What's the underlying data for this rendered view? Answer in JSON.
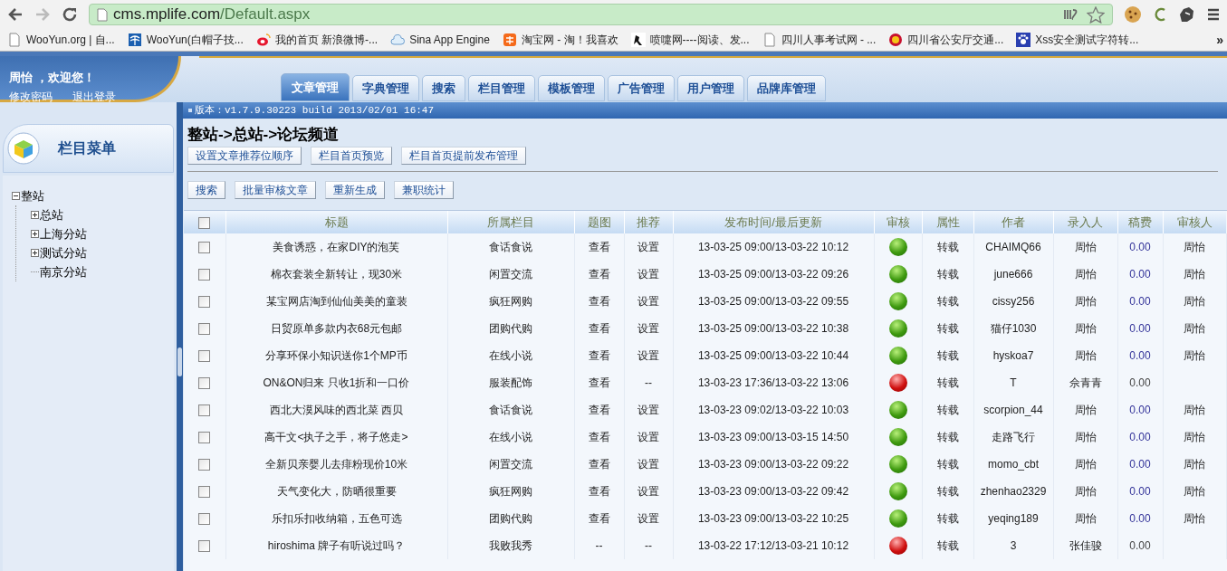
{
  "browser": {
    "address": {
      "host": "cms.mplife.com",
      "path": "/Default.aspx"
    },
    "bookmarks": [
      {
        "label": "WooYun.org | 自...",
        "kind": "page"
      },
      {
        "label": "WooYun(白帽子技...",
        "kind": "telecom"
      },
      {
        "label": "我的首页 新浪微博-...",
        "kind": "weibo"
      },
      {
        "label": "Sina App Engine",
        "kind": "cloud"
      },
      {
        "label": "淘宝网 - 淘！我喜欢",
        "kind": "shop"
      },
      {
        "label": "喷嚏网----阅读、发...",
        "kind": "figure"
      },
      {
        "label": "四川人事考试网 - ...",
        "kind": "page"
      },
      {
        "label": "四川省公安厅交通...",
        "kind": "emblem"
      },
      {
        "label": "Xss安全测试字符转...",
        "kind": "paw"
      }
    ],
    "more": "»"
  },
  "user": {
    "greeting": "周怡 ，欢迎您！",
    "links": [
      "修改密码",
      "退出登录"
    ]
  },
  "tabs": [
    {
      "label": "文章管理",
      "selected": true
    },
    {
      "label": "字典管理",
      "selected": false
    },
    {
      "label": "搜索",
      "selected": false
    },
    {
      "label": "栏目管理",
      "selected": false
    },
    {
      "label": "模板管理",
      "selected": false
    },
    {
      "label": "广告管理",
      "selected": false
    },
    {
      "label": "用户管理",
      "selected": false
    },
    {
      "label": "品牌库管理",
      "selected": false
    }
  ],
  "version": "版本：v1.7.9.30223 build 2013/02/01 16:47",
  "sidebar": {
    "title": "栏目菜单",
    "tree": [
      {
        "label": "整站",
        "kind": "folder",
        "expanded": true,
        "children": [
          {
            "label": "总站",
            "kind": "folder",
            "expanded": false
          },
          {
            "label": "上海分站",
            "kind": "folder",
            "expanded": false
          },
          {
            "label": "测试分站",
            "kind": "folder",
            "expanded": false
          },
          {
            "label": "南京分站",
            "kind": "leaf"
          }
        ]
      }
    ]
  },
  "breadcrumb": "整站->总站->论坛频道",
  "toolbar_1": [
    "设置文章推荐位顺序",
    "栏目首页预览",
    "栏目首页提前发布管理"
  ],
  "toolbar_2": [
    "搜索",
    "批量审核文章",
    "重新生成",
    "兼职统计"
  ],
  "table": {
    "select_all": {
      "checked": false
    },
    "columns": [
      "标题",
      "所属栏目",
      "题图",
      "推荐",
      "发布时间/最后更新",
      "审核",
      "属性",
      "作者",
      "录入人",
      "稿费",
      "审核人"
    ],
    "rows": [
      {
        "checked": false,
        "title": "美食诱惑，在家DIY的泡芙",
        "section": "食话食说",
        "image": "查看",
        "recommend": "设置",
        "time": "13-03-25 09:00/13-03-22 10:12",
        "approved": true,
        "attribute": "转载",
        "author": "CHAIMQ66",
        "editor": "周怡",
        "fee": "0.00",
        "reviewer": "周怡"
      },
      {
        "checked": false,
        "title": "棉衣套装全新转让，现30米",
        "section": "闲置交流",
        "image": "查看",
        "recommend": "设置",
        "time": "13-03-25 09:00/13-03-22 09:26",
        "approved": true,
        "attribute": "转载",
        "author": "june666",
        "editor": "周怡",
        "fee": "0.00",
        "reviewer": "周怡"
      },
      {
        "checked": false,
        "title": "某宝网店淘到仙仙美美的童装",
        "section": "疯狂网购",
        "image": "查看",
        "recommend": "设置",
        "time": "13-03-25 09:00/13-03-22 09:55",
        "approved": true,
        "attribute": "转载",
        "author": "cissy256",
        "editor": "周怡",
        "fee": "0.00",
        "reviewer": "周怡"
      },
      {
        "checked": false,
        "title": "日贸原单多款内衣68元包邮",
        "section": "团购代购",
        "image": "查看",
        "recommend": "设置",
        "time": "13-03-25 09:00/13-03-22 10:38",
        "approved": true,
        "attribute": "转载",
        "author": "猫仔1030",
        "editor": "周怡",
        "fee": "0.00",
        "reviewer": "周怡"
      },
      {
        "checked": false,
        "title": "分享环保小知识送你1个MP币",
        "section": "在线小说",
        "image": "查看",
        "recommend": "设置",
        "time": "13-03-25 09:00/13-03-22 10:44",
        "approved": true,
        "attribute": "转载",
        "author": "hyskoa7",
        "editor": "周怡",
        "fee": "0.00",
        "reviewer": "周怡"
      },
      {
        "checked": false,
        "title": "ON&ON归来 只收1折和一口价",
        "section": "服装配饰",
        "image": "查看",
        "recommend": "--",
        "time": "13-03-23 17:36/13-03-22 13:06",
        "approved": false,
        "attribute": "转载",
        "author": "T",
        "editor": "佘青青",
        "fee": "0.00"
      },
      {
        "checked": false,
        "title": "西北大漠风味的西北菜 西贝",
        "section": "食话食说",
        "image": "查看",
        "recommend": "设置",
        "time": "13-03-23 09:02/13-03-22 10:03",
        "approved": true,
        "attribute": "转载",
        "author": "scorpion_44",
        "editor": "周怡",
        "fee": "0.00",
        "reviewer": "周怡"
      },
      {
        "checked": false,
        "title": "高干文<执子之手，将子悠走>",
        "section": "在线小说",
        "image": "查看",
        "recommend": "设置",
        "time": "13-03-23 09:00/13-03-15 14:50",
        "approved": true,
        "attribute": "转载",
        "author": "走路飞行",
        "editor": "周怡",
        "fee": "0.00",
        "reviewer": "周怡"
      },
      {
        "checked": false,
        "title": "全新贝亲婴儿去痱粉现价10米",
        "section": "闲置交流",
        "image": "查看",
        "recommend": "设置",
        "time": "13-03-23 09:00/13-03-22 09:22",
        "approved": true,
        "attribute": "转载",
        "author": "momo_cbt",
        "editor": "周怡",
        "fee": "0.00",
        "reviewer": "周怡"
      },
      {
        "checked": false,
        "title": "天气变化大，防晒很重要",
        "section": "疯狂网购",
        "image": "查看",
        "recommend": "设置",
        "time": "13-03-23 09:00/13-03-22 09:42",
        "approved": true,
        "attribute": "转载",
        "author": "zhenhao2329",
        "editor": "周怡",
        "fee": "0.00",
        "reviewer": "周怡"
      },
      {
        "checked": false,
        "title": "乐扣乐扣收纳箱，五色可选",
        "section": "团购代购",
        "image": "查看",
        "recommend": "设置",
        "time": "13-03-23 09:00/13-03-22 10:25",
        "approved": true,
        "attribute": "转载",
        "author": "yeqing189",
        "editor": "周怡",
        "fee": "0.00",
        "reviewer": "周怡"
      },
      {
        "checked": false,
        "title": "hiroshima 牌子有听说过吗？",
        "section": "我败我秀",
        "image": "--",
        "recommend": "--",
        "time": "13-03-22 17:12/13-03-21 10:12",
        "approved": false,
        "attribute": "转载",
        "author": "3",
        "editor": "张佳骏",
        "fee": "0.00"
      }
    ]
  }
}
